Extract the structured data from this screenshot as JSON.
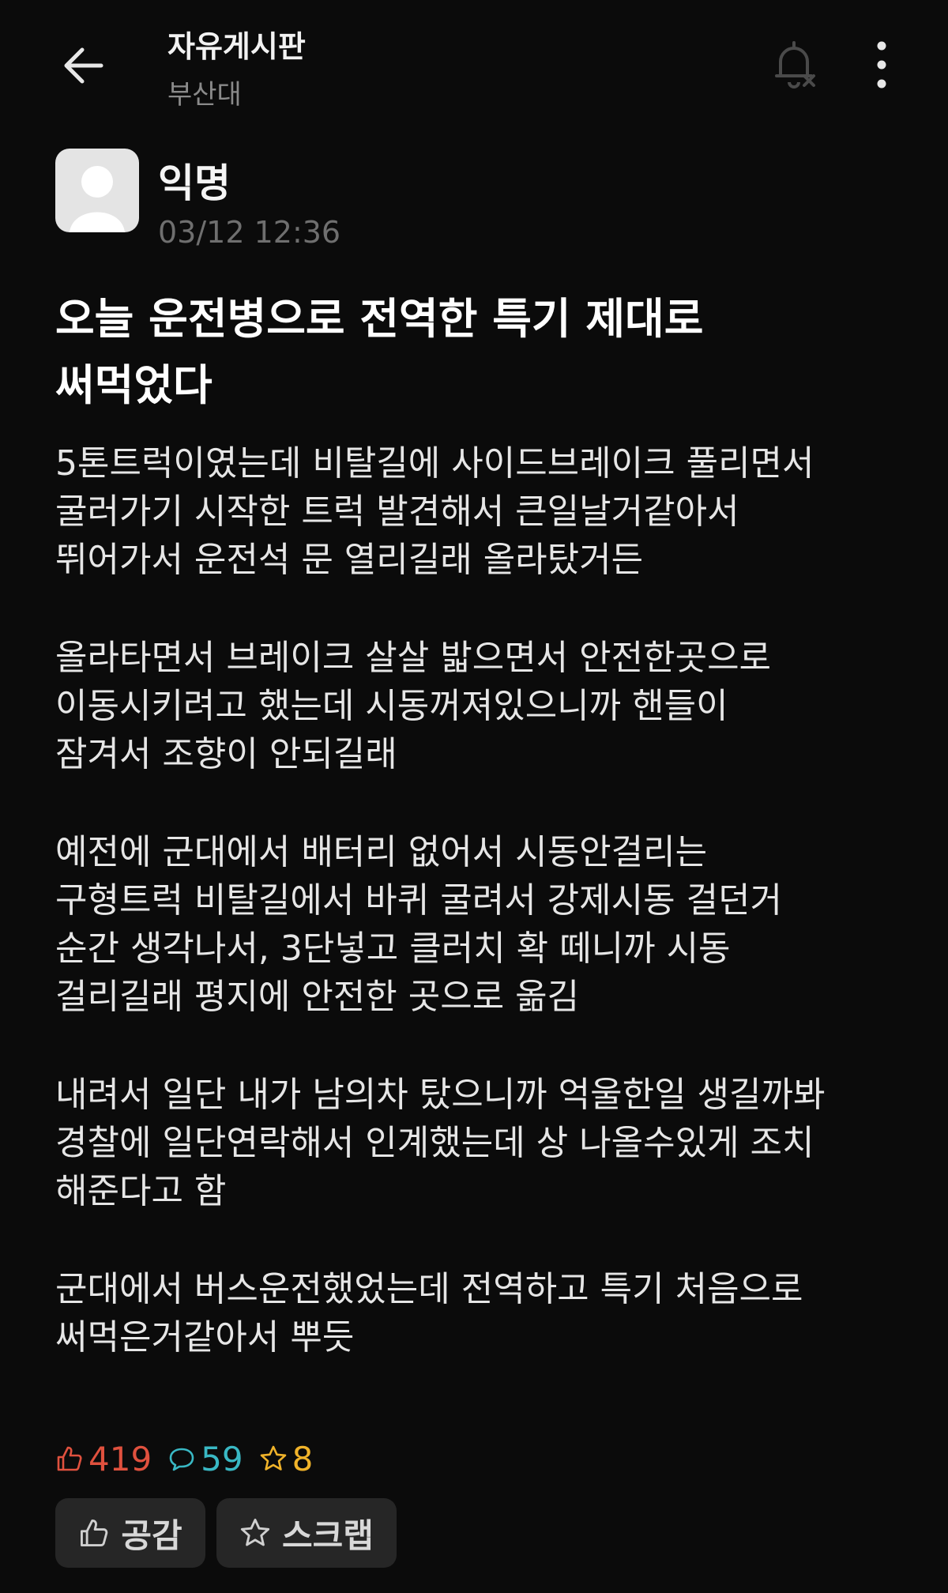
{
  "header": {
    "board_title": "자유게시판",
    "school": "부산대",
    "icons": {
      "back": "arrow-left-icon",
      "notify": "bell-off-icon",
      "more": "more-vertical-icon"
    }
  },
  "post": {
    "author": "익명",
    "time": "03/12 12:36",
    "title_lines": [
      "오늘 운전병으로 전역한 특기 제대로",
      "써먹었다"
    ],
    "paragraphs": [
      [
        "5톤트럭이였는데 비탈길에 사이드브레이크 풀리면서",
        "굴러가기 시작한 트럭 발견해서 큰일날거같아서",
        "뛰어가서 운전석 문 열리길래 올라탔거든"
      ],
      [
        "올라타면서 브레이크 살살 밟으면서 안전한곳으로",
        "이동시키려고 했는데 시동꺼져있으니까 핸들이",
        "잠겨서 조향이 안되길래"
      ],
      [
        "예전에 군대에서 배터리 없어서 시동안걸리는",
        "구형트럭 비탈길에서 바퀴 굴려서 강제시동 걸던거",
        "순간 생각나서, 3단넣고 클러치 확 떼니까 시동",
        "걸리길래 평지에 안전한 곳으로 옮김"
      ],
      [
        "내려서 일단 내가 남의차 탔으니까 억울한일 생길까봐",
        "경찰에 일단연락해서 인계했는데 상 나올수있게 조치",
        "해준다고 함"
      ],
      [
        "군대에서 버스운전했었는데 전역하고 특기 처음으로",
        "써먹은거같아서 뿌듯"
      ]
    ]
  },
  "stats": {
    "likes": "419",
    "comments": "59",
    "scraps": "8"
  },
  "actions": {
    "like_label": "공감",
    "scrap_label": "스크랩"
  },
  "colors": {
    "background": "#0b0b0b",
    "like": "#e0513e",
    "comment": "#39b8c4",
    "scrap": "#f0b32a",
    "button_bg": "#262626"
  }
}
